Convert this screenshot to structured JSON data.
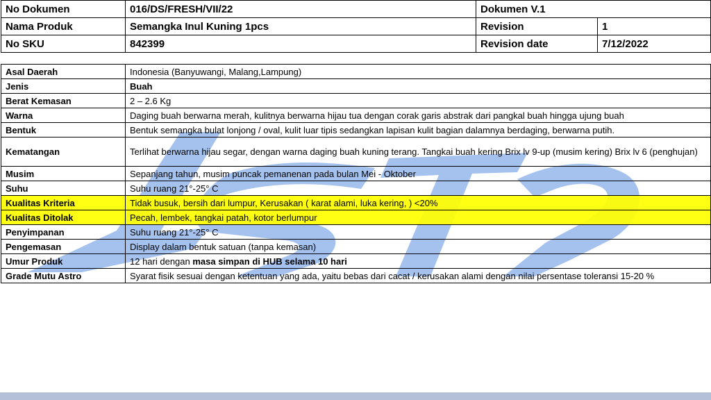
{
  "header": {
    "doc_no_label": "No Dokumen",
    "doc_no_value": "016/DS/FRESH/VII/22",
    "doc_version": "Dokumen V.1",
    "product_label": "Nama Produk",
    "product_value": "Semangka Inul Kuning 1pcs",
    "revision_label": "Revision",
    "revision_value": "1",
    "sku_label": "No SKU",
    "sku_value": "842399",
    "revision_date_label": "Revision date",
    "revision_date_value": "7/12/2022"
  },
  "spec": {
    "asal": {
      "label": "Asal Daerah",
      "value": "Indonesia (Banyuwangi, Malang,Lampung)"
    },
    "jenis": {
      "label": "Jenis",
      "value": "Buah"
    },
    "berat": {
      "label": "Berat Kemasan",
      "value": "2 – 2.6 Kg"
    },
    "warna": {
      "label": "Warna",
      "value": "Daging buah berwarna merah, kulitnya berwarna hijau tua dengan corak garis abstrak dari pangkal buah hingga ujung buah"
    },
    "bentuk": {
      "label": "Bentuk",
      "value": "Bentuk semangka bulat lonjong / oval, kulit luar tipis sedangkan lapisan kulit bagian dalamnya berdaging, berwarna putih."
    },
    "kematangan": {
      "label": "Kematangan",
      "value": "Terlihat berwarna hijau segar, dengan warna daging buah kuning terang. Tangkai buah kering Brix lv 9-up (musim kering) Brix lv 6 (penghujan)"
    },
    "musim": {
      "label": "Musim",
      "value": "Sepanjang tahun, musim puncak pemanenan pada bulan Mei - Oktober"
    },
    "suhu": {
      "label": "Suhu",
      "value": "Suhu ruang 21°-25° C"
    },
    "kriteria": {
      "label": "Kualitas Kriteria",
      "value": "Tidak busuk, bersih dari lumpur, Kerusakan ( karat alami, luka kering, ) <20%"
    },
    "ditolak": {
      "label": "Kualitas Ditolak",
      "value": "Pecah, lembek, tangkai patah, kotor berlumpur"
    },
    "penyimpanan": {
      "label": "Penyimpanan",
      "value": "Suhu ruang 21°-25° C"
    },
    "pengemasan": {
      "label": "Pengemasan",
      "value": "Display dalam bentuk satuan (tanpa kemasan)"
    },
    "umur": {
      "label": "Umur Produk",
      "value_prefix": "12 hari dengan ",
      "value_bold": "masa simpan di HUB selama 10 hari"
    },
    "grade": {
      "label": "Grade Mutu Astro",
      "value": "Syarat fisik sesuai dengan ketentuan yang ada, yaitu bebas dari cacat / kerusakan alami dengan  nilai persentase toleransi 15-20 %"
    }
  },
  "colors": {
    "highlight": "#ffff00",
    "watermark": "#8fb3ea",
    "footer_bar": "#b4c0d8"
  }
}
